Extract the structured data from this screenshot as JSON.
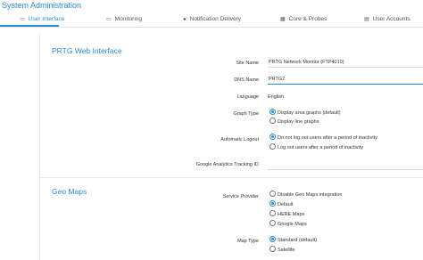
{
  "window": {
    "title": "System Administration"
  },
  "tabs": [
    {
      "label": "User Interface",
      "icon": "ui-icon",
      "active": true
    },
    {
      "label": "Monitoring",
      "icon": "monitor-icon"
    },
    {
      "label": "Notification Delivery",
      "icon": "bell-icon"
    },
    {
      "label": "Core & Probes",
      "icon": "grid-icon"
    },
    {
      "label": "User Accounts",
      "icon": "users-icon"
    }
  ],
  "web_interface": {
    "section_title": "PRTG Web Interface",
    "site_name": {
      "label": "Site Name",
      "value": "PRTG Network Monitor (FTP4010)"
    },
    "dns_name": {
      "label": "DNS Name",
      "value": "PRTG2"
    },
    "language": {
      "label": "Language",
      "value": "English"
    },
    "graph_type": {
      "label": "Graph Type",
      "options": [
        "Display area graphs (default)",
        "Display line graphs"
      ],
      "selected": 0
    },
    "automatic_logout": {
      "label": "Automatic Logout",
      "options": [
        "Do not log out users after a period of inactivity",
        "Log out users after a period of inactivity"
      ],
      "selected": 0
    },
    "google_analytics": {
      "label": "Google Analytics Tracking ID",
      "value": ""
    }
  },
  "geo_maps": {
    "section_title": "Geo Maps",
    "service_provider": {
      "label": "Service Provider",
      "options": [
        "Disable Geo Maps integration",
        "Default",
        "HERE Maps",
        "Google Maps"
      ],
      "selected": 1
    },
    "map_type": {
      "label": "Map Type",
      "options": [
        "Standard (default)",
        "Satellite"
      ],
      "selected": 0
    }
  },
  "colors": {
    "accent": "#2a8dd4"
  }
}
